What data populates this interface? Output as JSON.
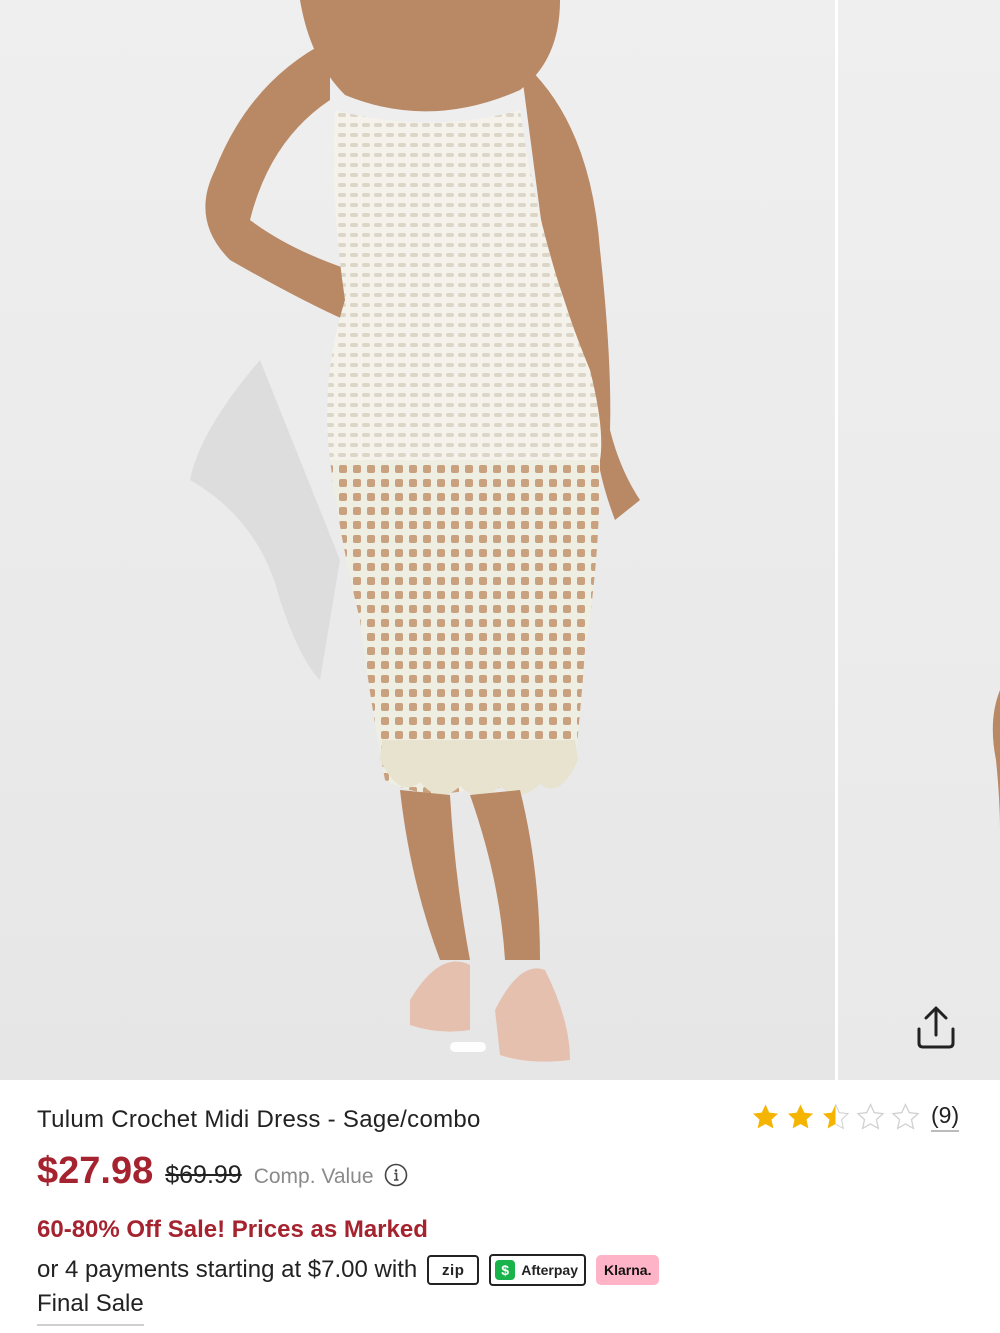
{
  "gallery": {
    "share_icon": "share-icon",
    "dots_count": 1
  },
  "product": {
    "title": "Tulum Crochet Midi Dress - Sage/combo",
    "rating": 2.5,
    "rating_max": 5,
    "review_count": "(9)",
    "sale_price": "$27.98",
    "original_price": "$69.99",
    "comp_value_label": "Comp. Value",
    "promo": "60-80% Off Sale! Prices as Marked",
    "payments_text": "or 4 payments starting at $7.00 with",
    "payment_logos": {
      "zip": "zip",
      "afterpay": "Afterpay",
      "afterpay_mark": "$",
      "klarna": "Klarna."
    },
    "final_sale": "Final Sale"
  },
  "colors": {
    "sale_red": "#a5232f",
    "star_gold": "#f4b400",
    "klarna_pink": "#ffb3c7",
    "afterpay_green": "#19b24b"
  }
}
